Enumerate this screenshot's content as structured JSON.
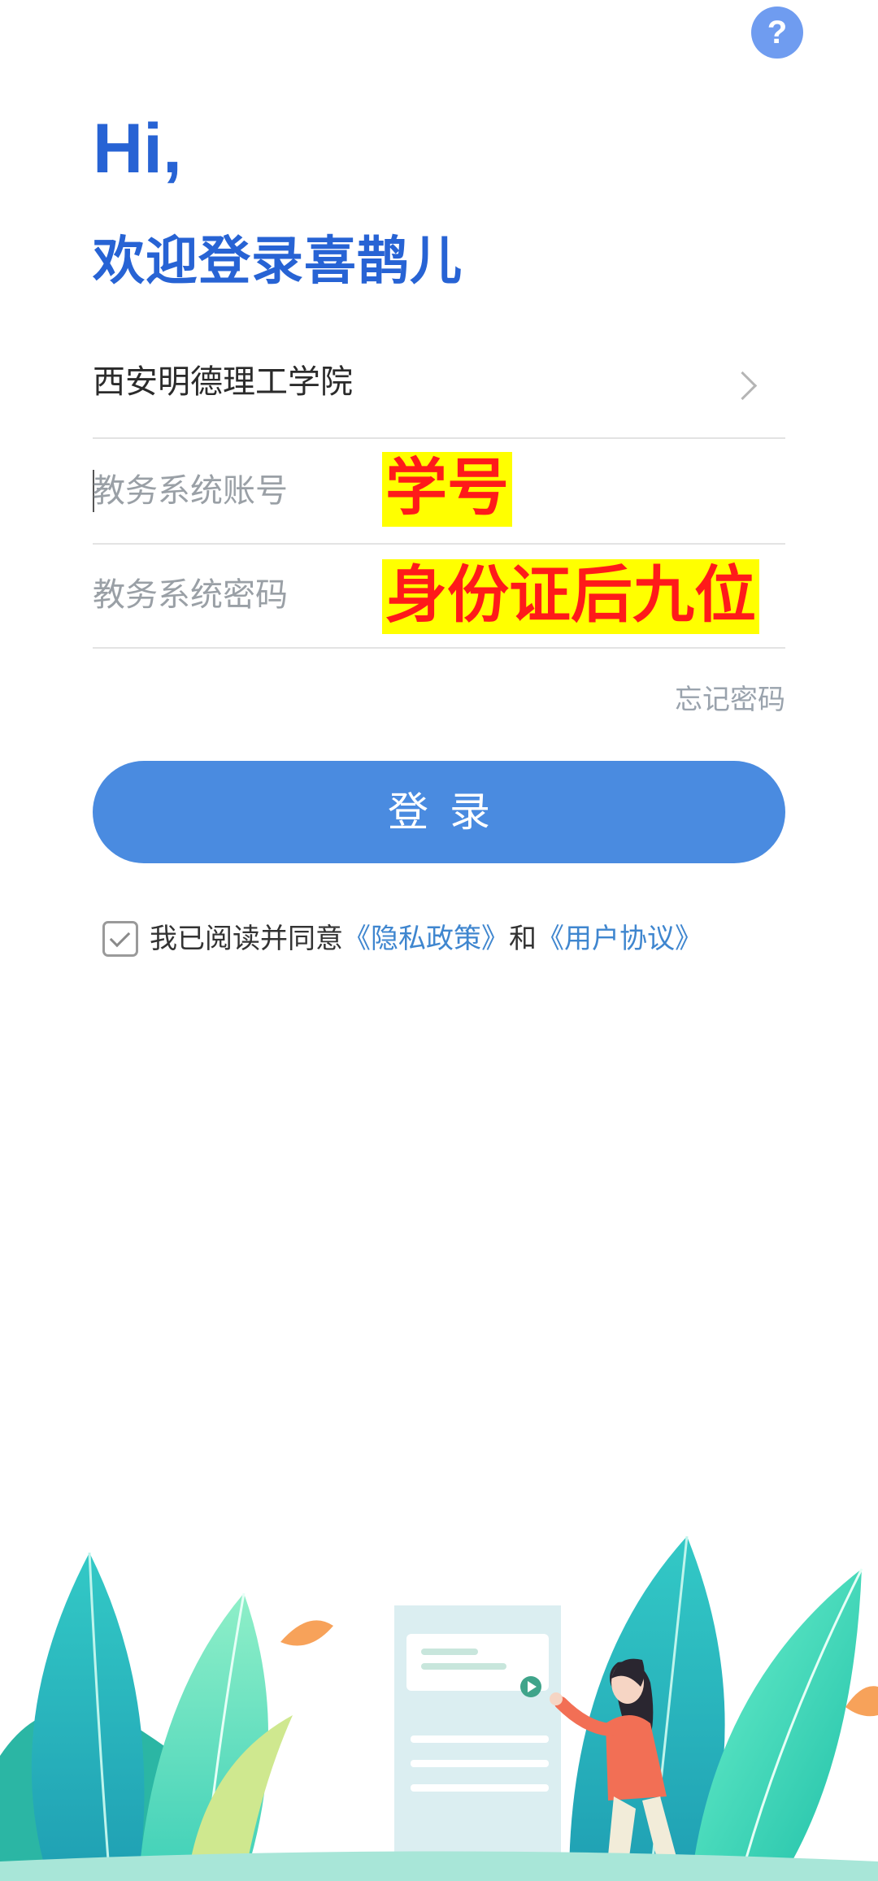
{
  "header": {
    "help_icon_glyph": "?"
  },
  "greeting": {
    "hi": "Hi,",
    "welcome": "欢迎登录喜鹊儿"
  },
  "form": {
    "school": "西安明德理工学院",
    "account_placeholder": "教务系统账号",
    "password_placeholder": "教务系统密码",
    "account_note": "学号",
    "password_note": "身份证后九位",
    "forgot": "忘记密码",
    "login": "登录"
  },
  "agreement": {
    "prefix": "我已阅读并同意",
    "privacy": "《隐私政策》",
    "and": "和",
    "terms": "《用户协议》",
    "checked": true
  },
  "colors": {
    "brand_blue": "#2763d4",
    "button_blue": "#4a8be0",
    "link_blue": "#3f86cf",
    "highlight_yellow": "#ffff00",
    "note_red": "#ff1a1a"
  }
}
